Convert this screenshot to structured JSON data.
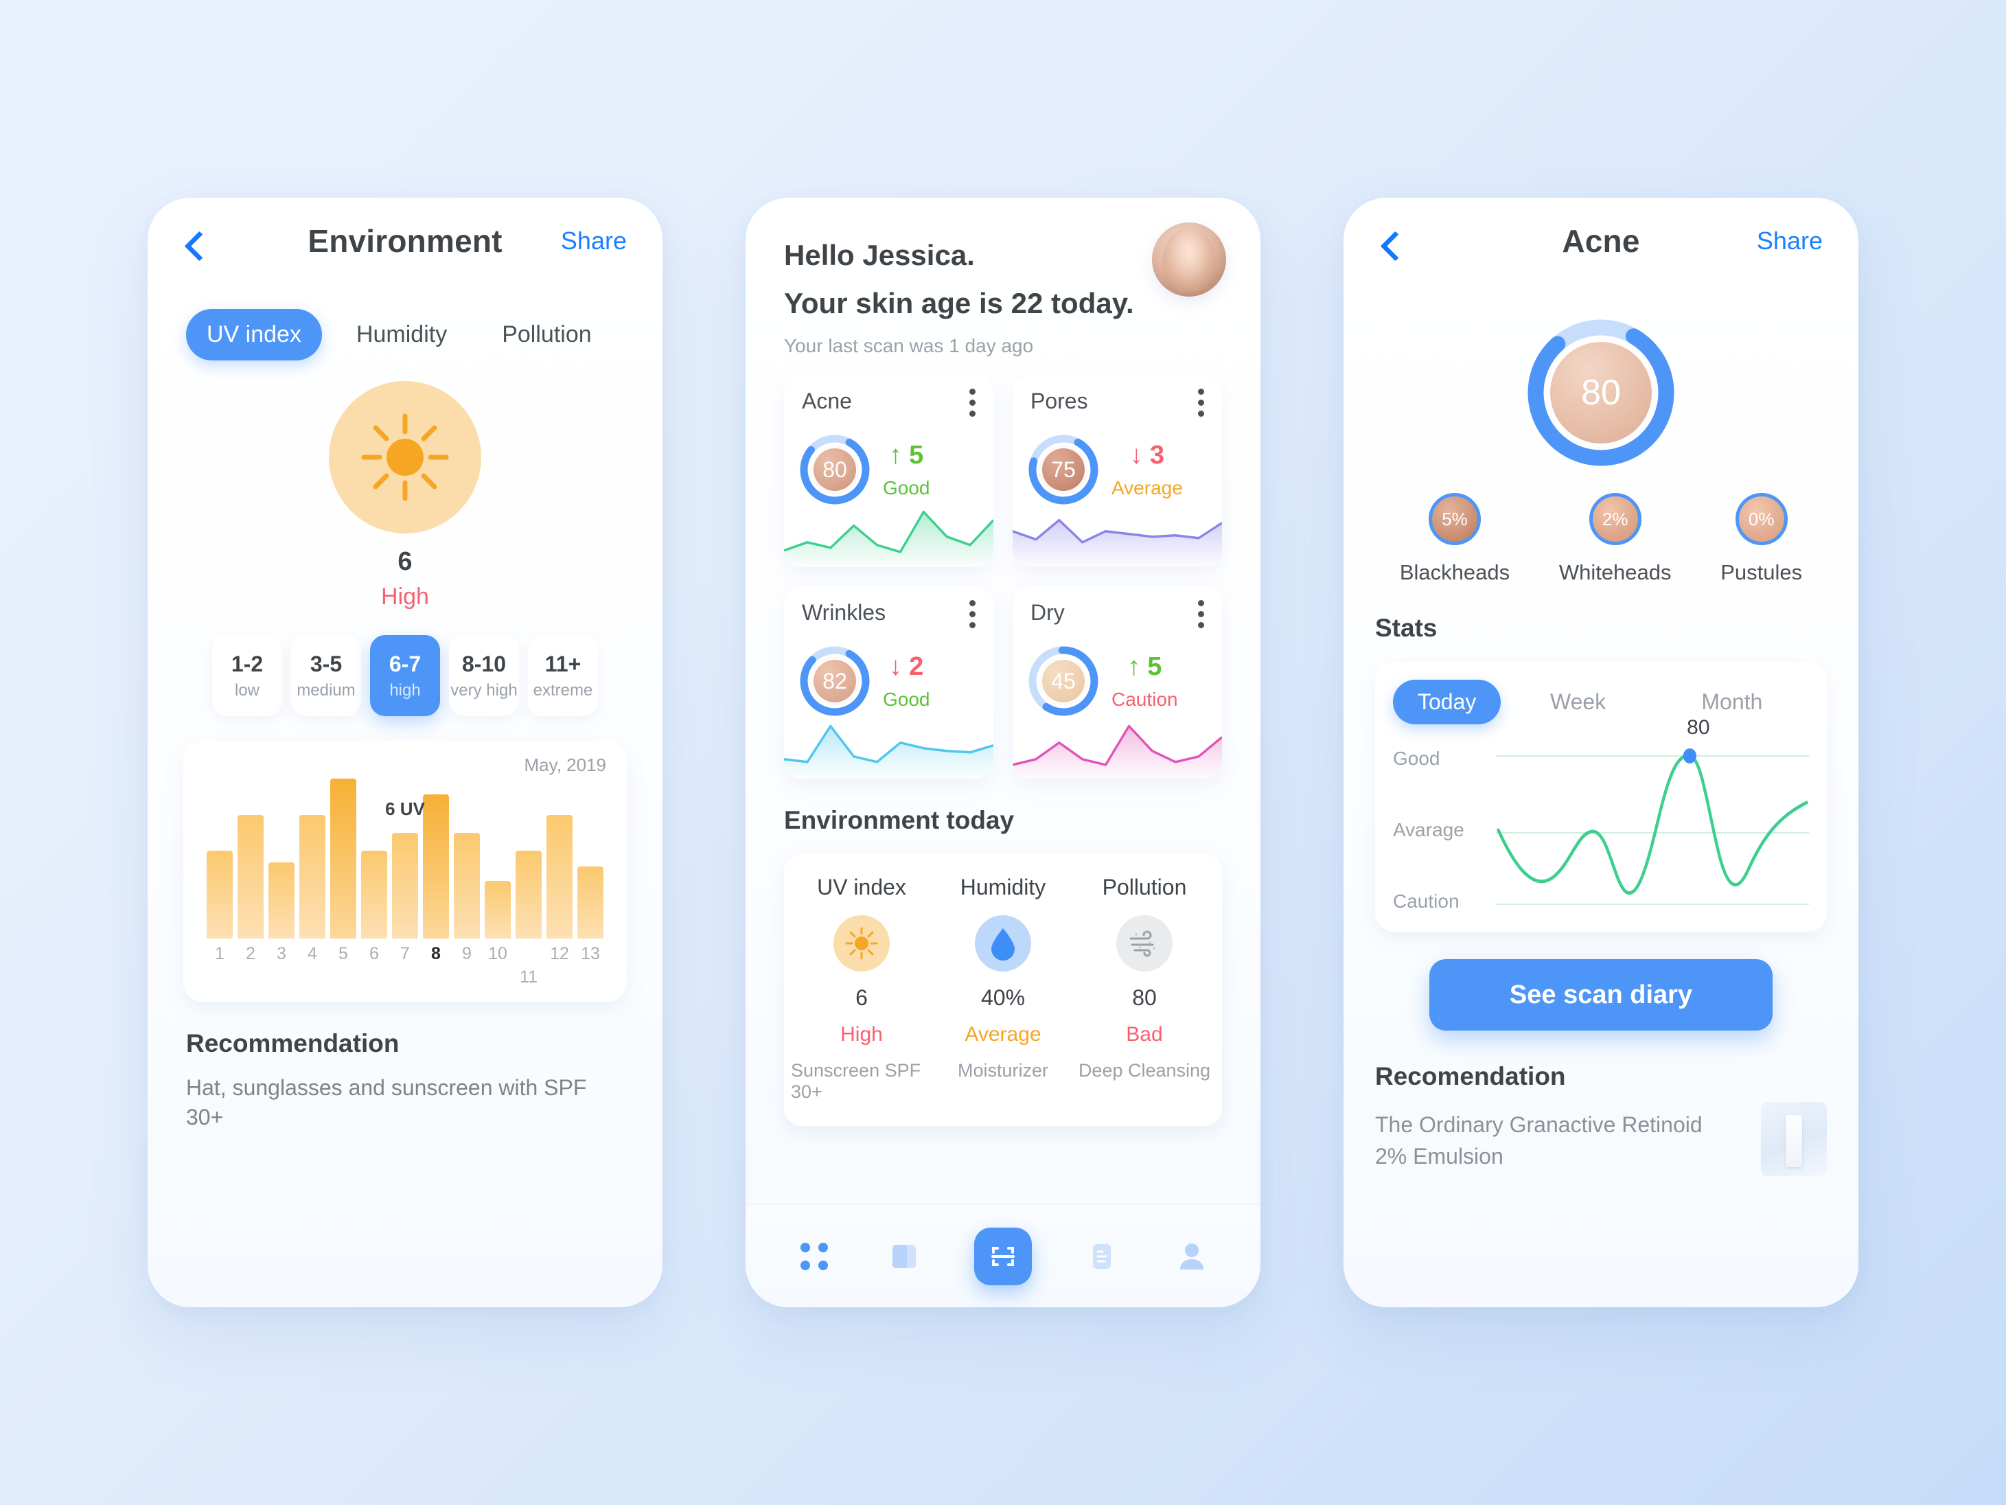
{
  "screen1": {
    "nav": {
      "back_icon": "chevron-left-icon",
      "title": "Environment",
      "share": "Share"
    },
    "segments": [
      {
        "label": "UV index",
        "active": true
      },
      {
        "label": "Humidity",
        "active": false
      },
      {
        "label": "Pollution",
        "active": false
      }
    ],
    "sun_icon": "sun-icon",
    "uv_value": "6",
    "uv_label": "High",
    "scale": [
      {
        "range": "1-2",
        "label": "low",
        "active": false
      },
      {
        "range": "3-5",
        "label": "medium",
        "active": false
      },
      {
        "range": "6-7",
        "label": "high",
        "active": true
      },
      {
        "range": "8-10",
        "label": "very high",
        "active": false
      },
      {
        "range": "11+",
        "label": "extreme",
        "active": false
      }
    ],
    "chart": {
      "month": "May, 2019",
      "peak_label": "6 UV"
    },
    "recommendation": {
      "title": "Recommendation",
      "text": "Hat, sunglasses and sunscreen with SPF 30+"
    }
  },
  "screen2": {
    "greeting": "Hello Jessica.",
    "skin_age": "Your skin age is 22 today.",
    "last_scan": "Your last scan was 1 day ago",
    "avatar_icon": "avatar-face",
    "metrics": [
      {
        "title": "Acne",
        "score": "80",
        "arrow": "↑",
        "delta": "5",
        "status": "Good",
        "delta_color": "#5bc236",
        "status_color": "#5bc236",
        "line_color": "#3ecf8e",
        "fill_color": "#3ecf8e"
      },
      {
        "title": "Pores",
        "score": "75",
        "arrow": "↓",
        "delta": "3",
        "status": "Average",
        "delta_color": "#f8606f",
        "status_color": "#f5a623",
        "line_color": "#8b84e8",
        "fill_color": "#8b84e8"
      },
      {
        "title": "Wrinkles",
        "score": "82",
        "arrow": "↓",
        "delta": "2",
        "status": "Good",
        "delta_color": "#f8606f",
        "status_color": "#5bc236",
        "line_color": "#4ec6ef",
        "fill_color": "#4ec6ef"
      },
      {
        "title": "Dry",
        "score": "45",
        "arrow": "↑",
        "delta": "5",
        "status": "Caution",
        "delta_color": "#5bc236",
        "status_color": "#f8606f",
        "line_color": "#e252b8",
        "fill_color": "#e252b8"
      }
    ],
    "env_title": "Environment today",
    "env": [
      {
        "header": "UV index",
        "icon": "sun-icon",
        "value": "6",
        "status": "High",
        "status_color": "#f8606f",
        "tip": "Sunscreen SPF 30+"
      },
      {
        "header": "Humidity",
        "icon": "water-drop-icon",
        "value": "40%",
        "status": "Average",
        "status_color": "#f5a623",
        "tip": "Moisturizer"
      },
      {
        "header": "Pollution",
        "icon": "smog-wind-icon",
        "value": "80",
        "status": "Bad",
        "status_color": "#f8606f",
        "tip": "Deep Cleansing"
      }
    ],
    "tabs": [
      {
        "icon": "grid-dots-icon",
        "active": false
      },
      {
        "icon": "cards-icon",
        "active": false
      },
      {
        "icon": "scan-icon",
        "active": true
      },
      {
        "icon": "document-icon",
        "active": false
      },
      {
        "icon": "person-icon",
        "active": false
      }
    ]
  },
  "screen3": {
    "nav": {
      "back_icon": "chevron-left-icon",
      "title": "Acne",
      "share": "Share"
    },
    "main_score": "80",
    "pills": [
      {
        "value": "5%",
        "label": "Blackheads"
      },
      {
        "value": "2%",
        "label": "Whiteheads"
      },
      {
        "value": "0%",
        "label": "Pustules"
      }
    ],
    "stats_title": "Stats",
    "stats_tabs": [
      {
        "label": "Today",
        "active": true
      },
      {
        "label": "Week",
        "active": false
      },
      {
        "label": "Month",
        "active": false
      }
    ],
    "cta": "See scan diary",
    "recommendation": {
      "title": "Recomendation",
      "text": "The Ordinary Granactive Retinoid 2% Emulsion",
      "product_icon": "product-bottle"
    }
  },
  "chart_data": [
    {
      "type": "bar",
      "title": "UV index by day",
      "subtitle": "May, 2019",
      "categories": [
        "1",
        "2",
        "3",
        "4",
        "5",
        "6",
        "7",
        "8",
        "9",
        "10",
        "11",
        "12",
        "13"
      ],
      "values": [
        4.4,
        6.2,
        3.8,
        6.2,
        8.0,
        4.4,
        5.3,
        7.2,
        5.3,
        2.9,
        4.4,
        6.2,
        3.6
      ],
      "highlight_index": 7,
      "highlight_label": "6 UV",
      "secondary_highlight_index": 4,
      "xlabel": "",
      "ylabel": "UV",
      "ylim": [
        0,
        9
      ],
      "grid": false,
      "legend": false
    },
    {
      "type": "line",
      "title": "Acne score — Today",
      "series": [
        {
          "name": "Acne",
          "values": [
            52,
            30,
            47,
            18,
            80,
            26,
            62
          ]
        }
      ],
      "x": [
        0,
        1,
        2,
        3,
        4,
        5,
        6
      ],
      "ytick_labels": [
        "Good",
        "Avarage",
        "Caution"
      ],
      "ytick_values": [
        80,
        50,
        20
      ],
      "ylim": [
        10,
        90
      ],
      "annotation": {
        "label": "80",
        "x": 4,
        "y": 80
      },
      "grid": true,
      "legend": false,
      "line_color": "#3ecf8e",
      "point_color": "#3d8ef7"
    },
    {
      "type": "area",
      "title": "Acne sparkline",
      "values": [
        12,
        18,
        14,
        30,
        16,
        11,
        40,
        22,
        16,
        34
      ],
      "line_color": "#3ecf8e"
    },
    {
      "type": "area",
      "title": "Pores sparkline",
      "values": [
        26,
        20,
        34,
        18,
        26,
        24,
        22,
        23,
        21,
        32
      ],
      "line_color": "#8b84e8"
    },
    {
      "type": "area",
      "title": "Wrinkles sparkline",
      "values": [
        14,
        12,
        38,
        16,
        12,
        26,
        22,
        20,
        19,
        24
      ],
      "line_color": "#4ec6ef"
    },
    {
      "type": "area",
      "title": "Dry sparkline",
      "values": [
        10,
        14,
        26,
        14,
        10,
        38,
        20,
        12,
        16,
        30
      ],
      "line_color": "#e252b8"
    }
  ]
}
